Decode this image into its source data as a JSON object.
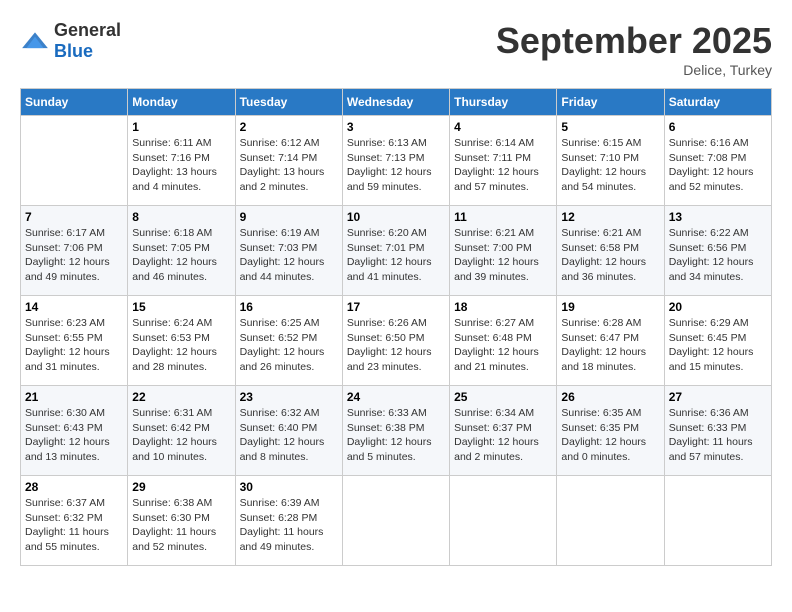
{
  "header": {
    "logo_general": "General",
    "logo_blue": "Blue",
    "month": "September 2025",
    "location": "Delice, Turkey"
  },
  "days_of_week": [
    "Sunday",
    "Monday",
    "Tuesday",
    "Wednesday",
    "Thursday",
    "Friday",
    "Saturday"
  ],
  "weeks": [
    [
      {
        "day": "",
        "sunrise": "",
        "sunset": "",
        "daylight": ""
      },
      {
        "day": "1",
        "sunrise": "Sunrise: 6:11 AM",
        "sunset": "Sunset: 7:16 PM",
        "daylight": "Daylight: 13 hours and 4 minutes."
      },
      {
        "day": "2",
        "sunrise": "Sunrise: 6:12 AM",
        "sunset": "Sunset: 7:14 PM",
        "daylight": "Daylight: 13 hours and 2 minutes."
      },
      {
        "day": "3",
        "sunrise": "Sunrise: 6:13 AM",
        "sunset": "Sunset: 7:13 PM",
        "daylight": "Daylight: 12 hours and 59 minutes."
      },
      {
        "day": "4",
        "sunrise": "Sunrise: 6:14 AM",
        "sunset": "Sunset: 7:11 PM",
        "daylight": "Daylight: 12 hours and 57 minutes."
      },
      {
        "day": "5",
        "sunrise": "Sunrise: 6:15 AM",
        "sunset": "Sunset: 7:10 PM",
        "daylight": "Daylight: 12 hours and 54 minutes."
      },
      {
        "day": "6",
        "sunrise": "Sunrise: 6:16 AM",
        "sunset": "Sunset: 7:08 PM",
        "daylight": "Daylight: 12 hours and 52 minutes."
      }
    ],
    [
      {
        "day": "7",
        "sunrise": "Sunrise: 6:17 AM",
        "sunset": "Sunset: 7:06 PM",
        "daylight": "Daylight: 12 hours and 49 minutes."
      },
      {
        "day": "8",
        "sunrise": "Sunrise: 6:18 AM",
        "sunset": "Sunset: 7:05 PM",
        "daylight": "Daylight: 12 hours and 46 minutes."
      },
      {
        "day": "9",
        "sunrise": "Sunrise: 6:19 AM",
        "sunset": "Sunset: 7:03 PM",
        "daylight": "Daylight: 12 hours and 44 minutes."
      },
      {
        "day": "10",
        "sunrise": "Sunrise: 6:20 AM",
        "sunset": "Sunset: 7:01 PM",
        "daylight": "Daylight: 12 hours and 41 minutes."
      },
      {
        "day": "11",
        "sunrise": "Sunrise: 6:21 AM",
        "sunset": "Sunset: 7:00 PM",
        "daylight": "Daylight: 12 hours and 39 minutes."
      },
      {
        "day": "12",
        "sunrise": "Sunrise: 6:21 AM",
        "sunset": "Sunset: 6:58 PM",
        "daylight": "Daylight: 12 hours and 36 minutes."
      },
      {
        "day": "13",
        "sunrise": "Sunrise: 6:22 AM",
        "sunset": "Sunset: 6:56 PM",
        "daylight": "Daylight: 12 hours and 34 minutes."
      }
    ],
    [
      {
        "day": "14",
        "sunrise": "Sunrise: 6:23 AM",
        "sunset": "Sunset: 6:55 PM",
        "daylight": "Daylight: 12 hours and 31 minutes."
      },
      {
        "day": "15",
        "sunrise": "Sunrise: 6:24 AM",
        "sunset": "Sunset: 6:53 PM",
        "daylight": "Daylight: 12 hours and 28 minutes."
      },
      {
        "day": "16",
        "sunrise": "Sunrise: 6:25 AM",
        "sunset": "Sunset: 6:52 PM",
        "daylight": "Daylight: 12 hours and 26 minutes."
      },
      {
        "day": "17",
        "sunrise": "Sunrise: 6:26 AM",
        "sunset": "Sunset: 6:50 PM",
        "daylight": "Daylight: 12 hours and 23 minutes."
      },
      {
        "day": "18",
        "sunrise": "Sunrise: 6:27 AM",
        "sunset": "Sunset: 6:48 PM",
        "daylight": "Daylight: 12 hours and 21 minutes."
      },
      {
        "day": "19",
        "sunrise": "Sunrise: 6:28 AM",
        "sunset": "Sunset: 6:47 PM",
        "daylight": "Daylight: 12 hours and 18 minutes."
      },
      {
        "day": "20",
        "sunrise": "Sunrise: 6:29 AM",
        "sunset": "Sunset: 6:45 PM",
        "daylight": "Daylight: 12 hours and 15 minutes."
      }
    ],
    [
      {
        "day": "21",
        "sunrise": "Sunrise: 6:30 AM",
        "sunset": "Sunset: 6:43 PM",
        "daylight": "Daylight: 12 hours and 13 minutes."
      },
      {
        "day": "22",
        "sunrise": "Sunrise: 6:31 AM",
        "sunset": "Sunset: 6:42 PM",
        "daylight": "Daylight: 12 hours and 10 minutes."
      },
      {
        "day": "23",
        "sunrise": "Sunrise: 6:32 AM",
        "sunset": "Sunset: 6:40 PM",
        "daylight": "Daylight: 12 hours and 8 minutes."
      },
      {
        "day": "24",
        "sunrise": "Sunrise: 6:33 AM",
        "sunset": "Sunset: 6:38 PM",
        "daylight": "Daylight: 12 hours and 5 minutes."
      },
      {
        "day": "25",
        "sunrise": "Sunrise: 6:34 AM",
        "sunset": "Sunset: 6:37 PM",
        "daylight": "Daylight: 12 hours and 2 minutes."
      },
      {
        "day": "26",
        "sunrise": "Sunrise: 6:35 AM",
        "sunset": "Sunset: 6:35 PM",
        "daylight": "Daylight: 12 hours and 0 minutes."
      },
      {
        "day": "27",
        "sunrise": "Sunrise: 6:36 AM",
        "sunset": "Sunset: 6:33 PM",
        "daylight": "Daylight: 11 hours and 57 minutes."
      }
    ],
    [
      {
        "day": "28",
        "sunrise": "Sunrise: 6:37 AM",
        "sunset": "Sunset: 6:32 PM",
        "daylight": "Daylight: 11 hours and 55 minutes."
      },
      {
        "day": "29",
        "sunrise": "Sunrise: 6:38 AM",
        "sunset": "Sunset: 6:30 PM",
        "daylight": "Daylight: 11 hours and 52 minutes."
      },
      {
        "day": "30",
        "sunrise": "Sunrise: 6:39 AM",
        "sunset": "Sunset: 6:28 PM",
        "daylight": "Daylight: 11 hours and 49 minutes."
      },
      {
        "day": "",
        "sunrise": "",
        "sunset": "",
        "daylight": ""
      },
      {
        "day": "",
        "sunrise": "",
        "sunset": "",
        "daylight": ""
      },
      {
        "day": "",
        "sunrise": "",
        "sunset": "",
        "daylight": ""
      },
      {
        "day": "",
        "sunrise": "",
        "sunset": "",
        "daylight": ""
      }
    ]
  ]
}
